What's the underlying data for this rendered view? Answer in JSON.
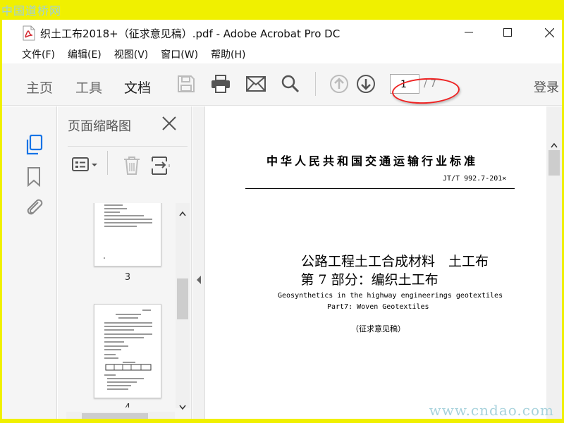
{
  "watermark": {
    "top": "中国道桥网",
    "bottom": "www.cndao.com"
  },
  "window": {
    "title": "织土工布2018+（征求意见稿）.pdf - Adobe Acrobat Pro DC",
    "controls": [
      "minimize",
      "maximize",
      "close"
    ]
  },
  "menu": {
    "items": [
      "文件(F)",
      "编辑(E)",
      "视图(V)",
      "窗口(W)",
      "帮助(H)"
    ]
  },
  "toolbar": {
    "tabs": [
      {
        "label": "主页",
        "active": false
      },
      {
        "label": "工具",
        "active": false
      },
      {
        "label": "文档",
        "active": true
      }
    ],
    "page_current": "1",
    "page_total": "/ 7",
    "login_label": "登录",
    "icons": [
      "save-icon",
      "print-icon",
      "mail-icon",
      "search-icon",
      "prev-page-icon",
      "next-page-icon"
    ]
  },
  "left_rail": {
    "icons": [
      "page-thumbnails-icon",
      "bookmark-icon",
      "attachment-icon"
    ]
  },
  "thumbnail_panel": {
    "title": "页面缩略图",
    "tools": [
      "thumbnail-options-icon",
      "delete-page-icon",
      "insert-page-icon"
    ],
    "pages": [
      {
        "number": "3"
      },
      {
        "number": "4"
      }
    ]
  },
  "document": {
    "header": "中华人民共和国交通运输行业标准",
    "code": "JT/T 992.7-201×",
    "title_line1": "公路工程土工合成材料　土工布",
    "title_line2": "第 7 部分：编织土工布",
    "en_line1": "Geosynthetics in the highway engineerings geotextiles",
    "en_line2": "Part7: Woven Geotextiles",
    "draft_note": "（征求意见稿）"
  },
  "colors": {
    "page_background": "#f0f000",
    "toolbar_background": "#f5f5f5",
    "annotation_ellipse": "#ee2222",
    "acrobat_red": "#d3232b"
  }
}
